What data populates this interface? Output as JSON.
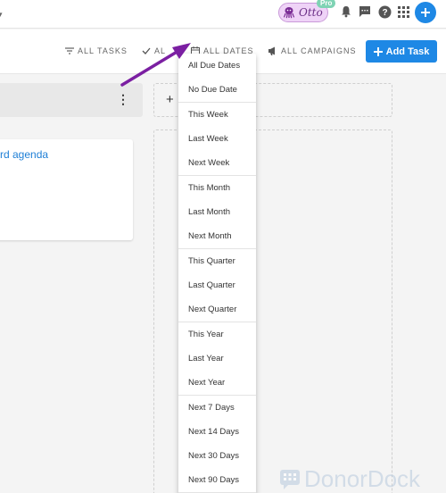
{
  "topbar": {
    "assistant_name": "Otto",
    "badge": "Pro",
    "icons": [
      "bell-icon",
      "chat-icon",
      "help-icon",
      "apps-grid-icon",
      "plus-icon"
    ]
  },
  "toolbar": {
    "filters": {
      "tasks": "ALL TASKS",
      "partial": "AL",
      "dates": "ALL DATES",
      "campaigns": "ALL CAMPAIGNS"
    },
    "add_task_label": "Add Task"
  },
  "board": {
    "card_title": "rd agenda"
  },
  "dropdown": {
    "groups": [
      [
        "All Due Dates",
        "No Due Date"
      ],
      [
        "This Week",
        "Last Week",
        "Next Week"
      ],
      [
        "This Month",
        "Last Month",
        "Next Month"
      ],
      [
        "This Quarter",
        "Last Quarter",
        "Next Quarter"
      ],
      [
        "This Year",
        "Last Year",
        "Next Year"
      ],
      [
        "Next 7 Days",
        "Next 14 Days",
        "Next 30 Days",
        "Next 90 Days"
      ]
    ]
  },
  "watermark": {
    "text": "DonorDock"
  },
  "colors": {
    "accent": "#1e88e5",
    "annotation_arrow": "#7b1fa2",
    "otto_bg": "#efd3f7"
  }
}
